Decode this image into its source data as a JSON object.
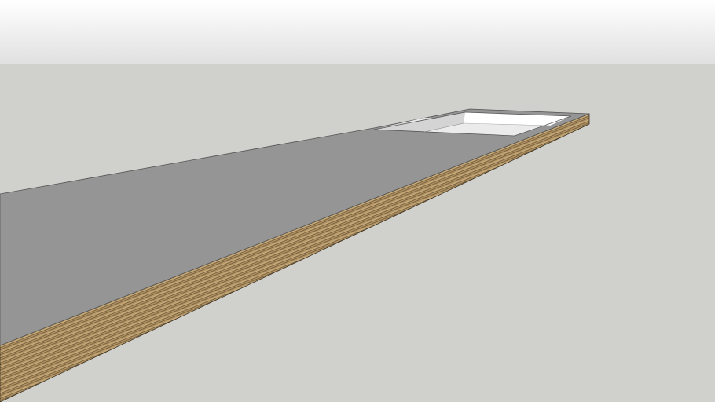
{
  "scene": {
    "colors": {
      "sky_top": "#ffffff",
      "sky_bottom": "#e0e0e0",
      "ground": "#d0d0cc",
      "countertop": "#959595",
      "wood_light": "#b89a68",
      "wood_dark": "#6e5838",
      "sink_wall_back": "#ffffff",
      "sink_wall_left": "#d4d4d4",
      "sink_floor": "#ebebeb"
    }
  }
}
